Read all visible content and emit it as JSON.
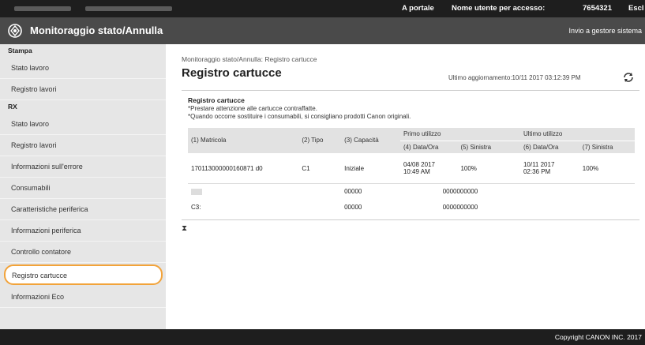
{
  "topbar": {
    "portal": "A portale",
    "user_label": "Nome utente per accesso:",
    "user_id": "7654321",
    "logout": "Escl"
  },
  "header": {
    "title": "Monitoraggio stato/Annulla",
    "mail_link": "Invio a gestore sistema"
  },
  "sidebar": {
    "sections": [
      {
        "label": "Stampa",
        "items": [
          "Stato lavoro",
          "Registro lavori"
        ]
      },
      {
        "label": "RX",
        "items": [
          "Stato lavoro",
          "Registro lavori",
          "Informazioni sull'errore",
          "Consumabili",
          "Caratteristiche periferica",
          "Informazioni periferica",
          "Controllo contatore",
          "Registro cartucce",
          "Informazioni Eco"
        ]
      }
    ],
    "active": "Registro cartucce"
  },
  "main": {
    "breadcrumb": "Monitoraggio stato/Annulla: Registro cartucce",
    "title": "Registro cartucce",
    "updated": "Ultimo aggiornamento:10/11 2017 03:12:39 PM",
    "panel_title": "Registro cartucce",
    "note1": "*Prestare attenzione alle cartucce contraffatte.",
    "note2": "*Quando occorre sostituire i consumabili, si consigliano prodotti Canon originali.",
    "table": {
      "headers": {
        "serial": "(1) Matricola",
        "type": "(2) Tipo",
        "capacity": "(3) Capacità",
        "first_use": "Primo utilizzo",
        "last_use": "Ultimo utilizzo",
        "first_date": "(4) Data/Ora",
        "first_left": "(5) Sinistra",
        "last_date": "(6) Data/Ora",
        "last_left": "(7) Sinistra"
      },
      "rows": [
        {
          "serial": "170113000000160871 d0",
          "type": "C1",
          "capacity": "Iniziale",
          "first_date_1": "04/08 2017",
          "first_date_2": "10:49 AM",
          "first_left": "100%",
          "last_date_1": "10/11 2017",
          "last_date_2": "02:36 PM",
          "last_left": "100%"
        },
        {
          "serial": "",
          "type": "",
          "capacity": "00000",
          "first_date_1": "0000000000",
          "first_left": "",
          "last_date_1": "",
          "last_left": ""
        },
        {
          "serial": "C3:",
          "type": "",
          "capacity": "00000",
          "first_date_1": "0000000000",
          "first_left": "",
          "last_date_1": "",
          "last_left": ""
        }
      ]
    },
    "footer_icon": "⧗"
  },
  "footer": {
    "copyright": "Copyright CANON INC. 2017"
  }
}
